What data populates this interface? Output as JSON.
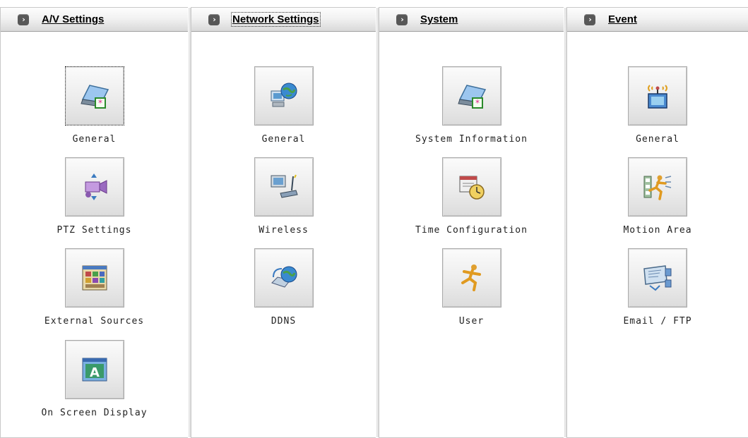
{
  "panels": [
    {
      "title": "A/V Settings",
      "items": [
        {
          "label": "General",
          "icon": "monitor-icon"
        },
        {
          "label": "PTZ Settings",
          "icon": "camera-rotate-icon"
        },
        {
          "label": "External Sources",
          "icon": "image-grid-icon"
        },
        {
          "label": "On Screen Display",
          "icon": "osd-text-icon"
        }
      ]
    },
    {
      "title": "Network Settings",
      "items": [
        {
          "label": "General",
          "icon": "network-globe-icon"
        },
        {
          "label": "Wireless",
          "icon": "wireless-router-icon"
        },
        {
          "label": "DDNS",
          "icon": "ddns-globe-icon"
        }
      ]
    },
    {
      "title": "System",
      "items": [
        {
          "label": "System Information",
          "icon": "monitor-icon"
        },
        {
          "label": "Time Configuration",
          "icon": "clock-icon"
        },
        {
          "label": "User",
          "icon": "user-running-icon"
        }
      ]
    },
    {
      "title": "Event",
      "items": [
        {
          "label": "General",
          "icon": "event-signal-icon"
        },
        {
          "label": "Motion Area",
          "icon": "motion-icon"
        },
        {
          "label": "Email / FTP",
          "icon": "email-ftp-icon"
        }
      ]
    }
  ],
  "colors": {
    "header_arrow": "#585858",
    "panel_border": "#c9c9c9"
  }
}
